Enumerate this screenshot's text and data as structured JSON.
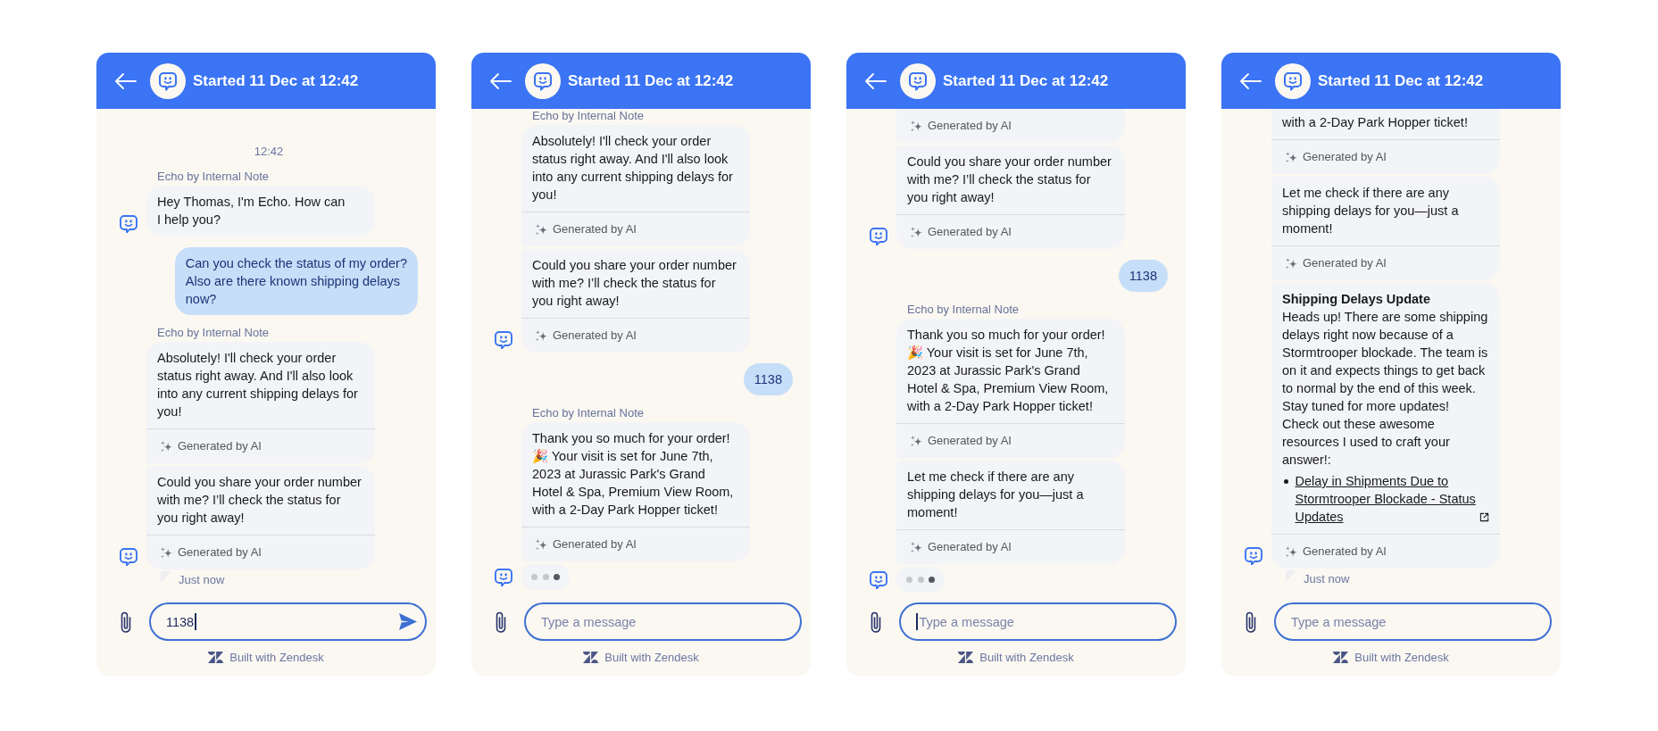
{
  "panels": [
    {
      "header": {
        "title": "Started 11 Dec at 12:42"
      },
      "thread": [
        {
          "kind": "time",
          "text": "12:42"
        },
        {
          "kind": "bot",
          "sender": "Echo by Internal Note",
          "messages": [
            {
              "kind": "text",
              "text": "Hey Thomas, I'm Echo. How can\nI help you?",
              "cut_top": false
            }
          ]
        },
        {
          "kind": "user",
          "text": "Can you check the status of my order?\nAlso are there known shipping delays\nnow?"
        },
        {
          "kind": "bot",
          "sender": "Echo by Internal Note",
          "messages": [
            {
              "kind": "text",
              "text": "Absolutely! I'll check your order\nstatus right away. And I'll also look\ninto any current shipping delays for\nyou!",
              "footer": "Generated by AI",
              "cut_top": false
            },
            {
              "kind": "text",
              "text": "Could you share your order number\nwith me? I’ll check the status for\nyou right away!",
              "footer": "Generated by AI",
              "cut_top": false
            }
          ],
          "status": "Just now"
        }
      ],
      "composer": {
        "value": "1138",
        "focused": true
      },
      "footer": "Built with Zendesk"
    },
    {
      "header": {
        "title": "Started 11 Dec at 12:42"
      },
      "thread": [
        {
          "kind": "bot",
          "sender": "Echo by Internal Note",
          "messages": [
            {
              "kind": "text",
              "text": "Absolutely! I'll check your order\nstatus right away. And I'll also look\ninto any current shipping delays for\nyou!",
              "footer": "Generated by AI",
              "cut_top": false
            },
            {
              "kind": "text",
              "text": "Could you share your order number\nwith me? I’ll check the status for\nyou right away!",
              "footer": "Generated by AI",
              "cut_top": false
            }
          ]
        },
        {
          "kind": "user",
          "text": "1138"
        },
        {
          "kind": "bot",
          "sender": "Echo by Internal Note",
          "messages": [
            {
              "kind": "text",
              "text": "Thank you so much for your order!\n🎉 Your visit is set for June 7th,\n2023 at Jurassic Park's Grand\nHotel & Spa, Premium View Room,\nwith a 2-Day Park Hopper ticket!",
              "footer": "Generated by AI",
              "cut_top": false
            },
            {
              "kind": "typing",
              "cut_top": false,
              "dots": [
                {
                  "active": false
                },
                {
                  "active": false
                },
                {
                  "active": true
                }
              ]
            }
          ]
        }
      ],
      "composer": {
        "placeholder": "Type a message",
        "focused": false
      },
      "footer": "Built with Zendesk"
    },
    {
      "header": {
        "title": "Started 11 Dec at 12:42"
      },
      "thread": [
        {
          "kind": "bot",
          "messages": [
            {
              "kind": "text",
              "footer": "Generated by AI",
              "cut_top": true
            },
            {
              "kind": "text",
              "text": "Could you share your order number\nwith me? I’ll check the status for\nyou right away!",
              "footer": "Generated by AI",
              "cut_top": false
            }
          ]
        },
        {
          "kind": "user",
          "text": "1138"
        },
        {
          "kind": "bot",
          "sender": "Echo by Internal Note",
          "messages": [
            {
              "kind": "text",
              "text": "Thank you so much for your order!\n🎉 Your visit is set for June 7th,\n2023 at Jurassic Park's Grand\nHotel & Spa, Premium View Room,\nwith a 2-Day Park Hopper ticket!",
              "footer": "Generated by AI",
              "cut_top": false
            },
            {
              "kind": "text",
              "text": "Let me check if there are any\nshipping delays for you—just a\nmoment!",
              "footer": "Generated by AI",
              "cut_top": false
            },
            {
              "kind": "typing",
              "cut_top": false,
              "dots": [
                {
                  "active": false
                },
                {
                  "active": false
                },
                {
                  "active": true
                }
              ]
            }
          ]
        }
      ],
      "composer": {
        "placeholder": "Type a message",
        "focused": true
      },
      "footer": "Built with Zendesk"
    },
    {
      "header": {
        "title": "Started 11 Dec at 12:42"
      },
      "thread": [
        {
          "kind": "bot",
          "messages": [
            {
              "kind": "text",
              "text": "with a 2-Day Park Hopper ticket!",
              "footer": "Generated by AI",
              "cut_top": true
            },
            {
              "kind": "text",
              "text": "Let me check if there are any\nshipping delays for you—just a\nmoment!",
              "footer": "Generated by AI",
              "cut_top": false
            },
            {
              "kind": "text",
              "title": "Shipping Delays Update",
              "text": "Heads up! There are some shipping\ndelays right now because of a\nStormtrooper blockade. The team is\non it and expects things to get back\nto normal by the end of this week.\nStay tuned for more updates!\nCheck out these awesome\nresources I used to craft your\nanswer!:",
              "links": [
                "Delay in Shipments Due to\nStormtrooper Blockade - Status\nUpdates"
              ],
              "footer": "Generated by AI",
              "cut_top": false
            }
          ],
          "status": "Just now"
        }
      ],
      "composer": {
        "placeholder": "Type a message",
        "focused": false
      },
      "footer": "Built with Zendesk"
    }
  ]
}
